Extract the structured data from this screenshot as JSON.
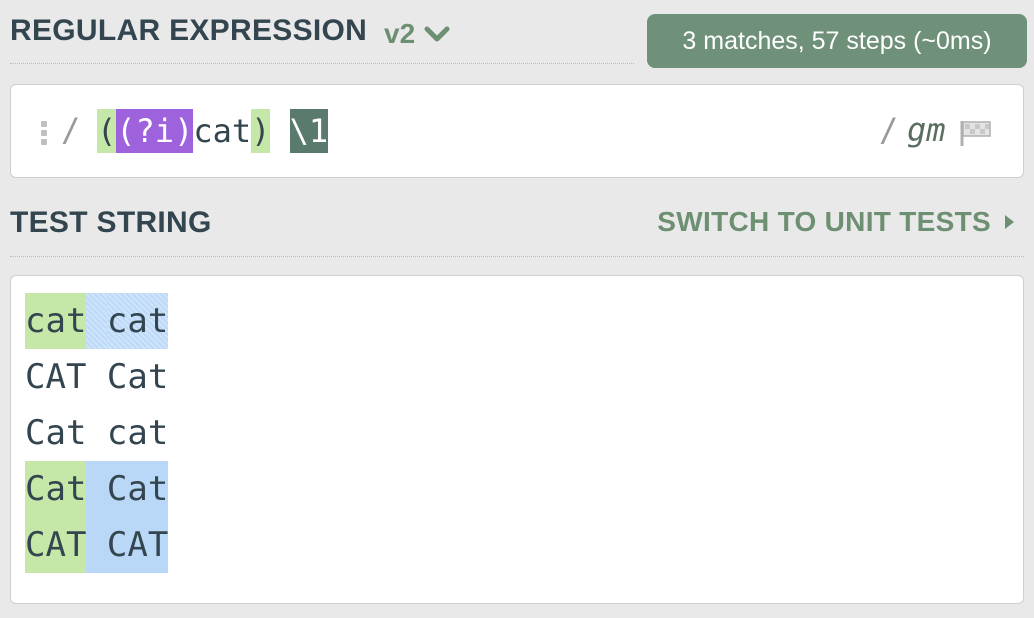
{
  "regex": {
    "title": "REGULAR EXPRESSION",
    "version": "v2",
    "match_info": "3 matches, 57 steps (~0ms)",
    "delimiter_open": "/",
    "delimiter_close": "/",
    "flags": "gm",
    "tokens": {
      "open_group": "(",
      "inline_flag": "(?i)",
      "literal": "cat",
      "close_group": ")",
      "space": " ",
      "backref": "\\1"
    }
  },
  "test": {
    "title": "TEST STRING",
    "switch_label": "SWITCH TO UNIT TESTS",
    "lines": [
      {
        "a": "cat",
        "sep": " ",
        "b": "cat",
        "match": true
      },
      {
        "a": "CAT",
        "sep": " ",
        "b": "Cat",
        "match": false
      },
      {
        "a": "Cat",
        "sep": " ",
        "b": "cat",
        "match": false
      },
      {
        "a": "Cat",
        "sep": " ",
        "b": "Cat",
        "match": true
      },
      {
        "a": "CAT",
        "sep": " ",
        "b": "CAT",
        "match": true
      }
    ]
  },
  "colors": {
    "group_highlight": "#c5e8a8",
    "flag_highlight": "#9f62dd",
    "backref_highlight": "#597a6d",
    "match_highlight": "#b9d7f6",
    "badge": "#6f9179"
  },
  "icons": {
    "version_chevron": "chevron-down-icon",
    "flag": "flag-icon",
    "drag": "drag-handle-icon",
    "switch_arrow": "triangle-right-icon"
  }
}
